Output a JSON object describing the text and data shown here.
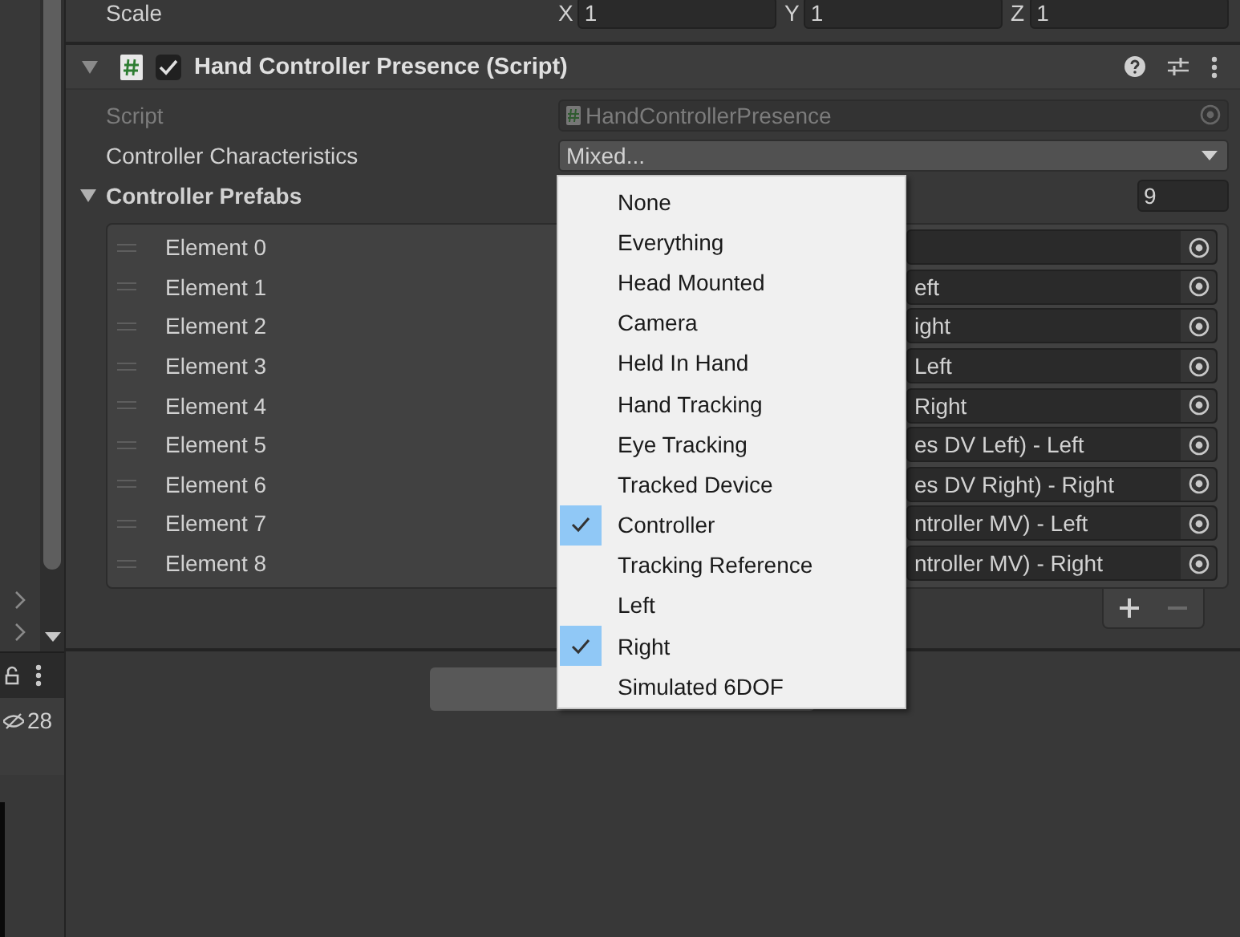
{
  "left_panel": {
    "count": "28"
  },
  "scale": {
    "label": "Scale",
    "axes": [
      {
        "axis": "X",
        "value": "1"
      },
      {
        "axis": "Y",
        "value": "1"
      },
      {
        "axis": "Z",
        "value": "1"
      }
    ]
  },
  "component": {
    "title": "Hand Controller Presence (Script)",
    "enabled": true,
    "expanded": true,
    "script": {
      "label": "Script",
      "value": "HandControllerPresence"
    },
    "characteristics": {
      "label": "Controller Characteristics",
      "value": "Mixed..."
    },
    "prefabs": {
      "label": "Controller Prefabs",
      "expanded": true,
      "size": "9",
      "elements": [
        {
          "label": "Element 0"
        },
        {
          "label": "Element 1",
          "value": "eft"
        },
        {
          "label": "Element 2",
          "value": "ight"
        },
        {
          "label": "Element 3",
          "value": "Left"
        },
        {
          "label": "Element 4",
          "value": "Right"
        },
        {
          "label": "Element 5",
          "value": "es DV Left) - Left"
        },
        {
          "label": "Element 6",
          "value": "es DV Right) - Right"
        },
        {
          "label": "Element 7",
          "value": "ntroller MV) - Left"
        },
        {
          "label": "Element 8",
          "value": "ntroller MV) - Right"
        }
      ]
    }
  },
  "dropdown_menu": {
    "items": [
      {
        "label": "None",
        "checked": false
      },
      {
        "label": "Everything",
        "checked": false
      },
      {
        "label": "Head Mounted",
        "checked": false
      },
      {
        "label": "Camera",
        "checked": false
      },
      {
        "label": "Held In Hand",
        "checked": false
      },
      {
        "label": "Hand Tracking",
        "checked": false
      },
      {
        "label": "Eye Tracking",
        "checked": false
      },
      {
        "label": "Tracked Device",
        "checked": false
      },
      {
        "label": "Controller",
        "checked": true
      },
      {
        "label": "Tracking Reference",
        "checked": false
      },
      {
        "label": "Left",
        "checked": false
      },
      {
        "label": "Right",
        "checked": true
      },
      {
        "label": "Simulated 6DOF",
        "checked": false
      }
    ]
  }
}
